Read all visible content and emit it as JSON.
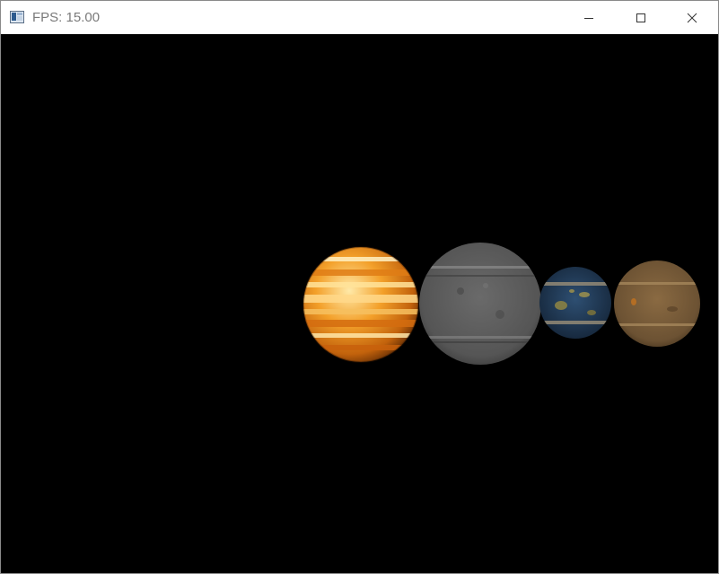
{
  "window": {
    "title": "FPS: 15.00",
    "icon": "app-window-icon",
    "controls": {
      "minimize_icon": "minimize-icon",
      "maximize_icon": "maximize-icon",
      "close_icon": "close-icon"
    }
  },
  "scene": {
    "background_color": "#000000",
    "planets": [
      {
        "name": "jupiter-like",
        "texture": "orange-banded"
      },
      {
        "name": "moon-like",
        "texture": "grey-cratered"
      },
      {
        "name": "earth-like",
        "texture": "blue-green"
      },
      {
        "name": "mars-like",
        "texture": "brown-dusty"
      }
    ]
  }
}
